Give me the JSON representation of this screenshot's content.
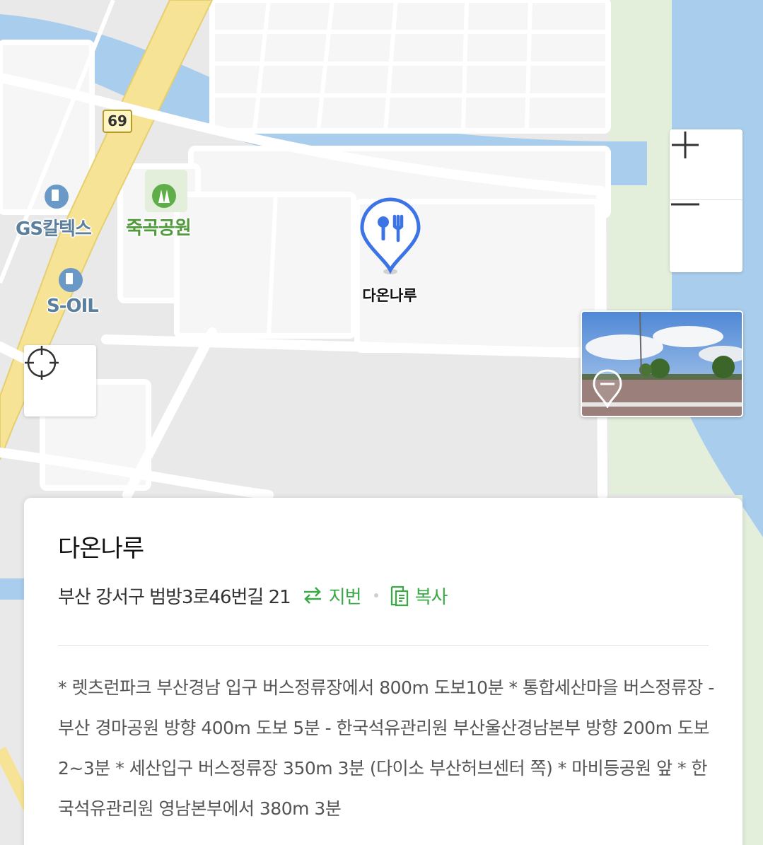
{
  "map": {
    "route_number": "69",
    "pois": {
      "gas_station_1": "GS칼텍스",
      "gas_station_2": "S-OIL",
      "park": "죽곡공원"
    },
    "marker": {
      "label": "다온나루",
      "icon": "restaurant-fork-knife-icon",
      "color": "#3c74e6"
    },
    "colors": {
      "water": "#a9cdec",
      "greenery": "#e3eedb",
      "road_main": "#f7e396",
      "block": "#f6f6f6",
      "background": "#e9e9e9"
    }
  },
  "controls": {
    "zoom_in_icon": "plus-icon",
    "zoom_out_icon": "minus-icon",
    "locate_icon": "crosshair-icon",
    "streetview_icon": "streetview-pin-icon"
  },
  "place": {
    "name": "다온나루",
    "address": "부산 강서구 범방3로46번길 21",
    "lot_number_label": "지번",
    "copy_label": "복사",
    "accent_color": "#3aa946",
    "directions": "* 렛츠런파크 부산경남 입구 버스정류장에서 800m 도보10분 * 통합세산마을 버스정류장 - 부산 경마공원 방향 400m 도보 5분 - 한국석유관리원 부산울산경남본부 방향 200m 도보 2~3분 * 세산입구 버스정류장 350m 3분 (다이소 부산허브센터 쪽) * 마비등공원 앞 * 한국석유관리원 영남본부에서 380m 3분"
  }
}
